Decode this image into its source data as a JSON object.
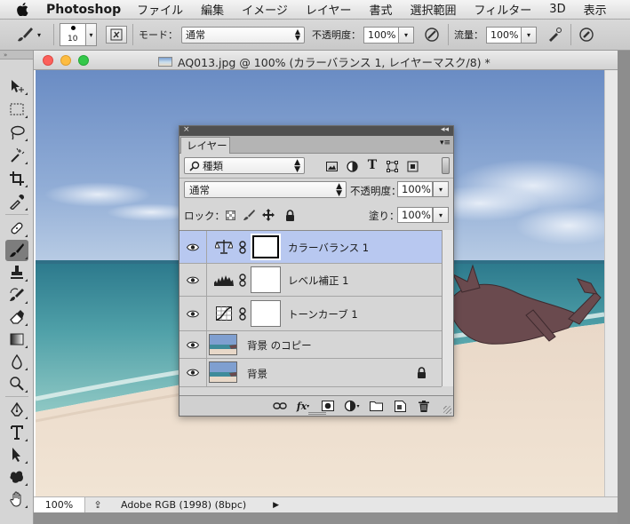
{
  "menubar": {
    "app_name": "Photoshop",
    "items": [
      "ファイル",
      "編集",
      "イメージ",
      "レイヤー",
      "書式",
      "選択範囲",
      "フィルター",
      "3D",
      "表示"
    ]
  },
  "options_bar": {
    "brush_size": "10",
    "mode_label": "モード：",
    "mode_value": "通常",
    "opacity_label": "不透明度：",
    "opacity_value": "100%",
    "flow_label": "流量：",
    "flow_value": "100%"
  },
  "document": {
    "title": "AQ013.jpg @ 100% (カラーバランス 1, レイヤーマスク/8) *",
    "zoom": "100%",
    "color_profile": "Adobe RGB (1998) (8bpc)"
  },
  "layers_panel": {
    "tab_label": "レイヤー",
    "filter_kind": "種類",
    "blend_mode": "通常",
    "opacity_label": "不透明度：",
    "opacity_value": "100%",
    "lock_label": "ロック：",
    "fill_label": "塗り：",
    "fill_value": "100%",
    "layers": [
      {
        "name": "カラーバランス 1",
        "type": "color-balance",
        "selected": true
      },
      {
        "name": "レベル補正 1",
        "type": "levels",
        "selected": false
      },
      {
        "name": "トーンカーブ 1",
        "type": "curves",
        "selected": false
      },
      {
        "name": "背景 のコピー",
        "type": "image",
        "selected": false
      },
      {
        "name": "背景",
        "type": "image",
        "locked": true,
        "selected": false
      }
    ],
    "footer_fx": "fx"
  },
  "colors": {
    "selected_layer": "#b8c8f0",
    "panel_bg": "#d6d6d6",
    "active_tool": "#7d7d7d"
  }
}
